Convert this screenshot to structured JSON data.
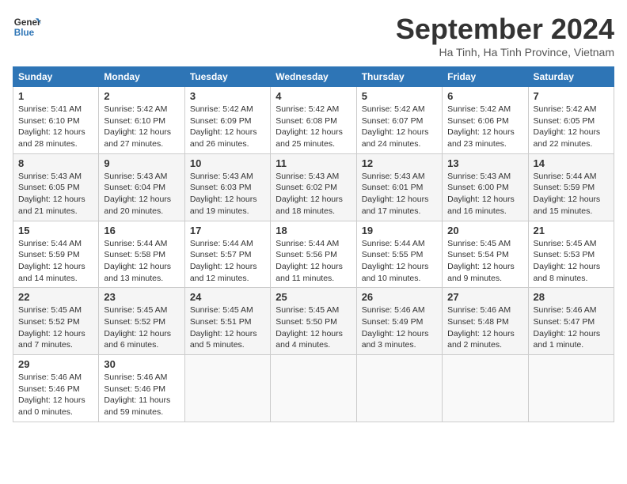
{
  "header": {
    "logo_line1": "General",
    "logo_line2": "Blue",
    "month_title": "September 2024",
    "location": "Ha Tinh, Ha Tinh Province, Vietnam"
  },
  "days_of_week": [
    "Sunday",
    "Monday",
    "Tuesday",
    "Wednesday",
    "Thursday",
    "Friday",
    "Saturday"
  ],
  "weeks": [
    [
      {
        "day": "1",
        "lines": [
          "Sunrise: 5:41 AM",
          "Sunset: 6:10 PM",
          "Daylight: 12 hours",
          "and 28 minutes."
        ]
      },
      {
        "day": "2",
        "lines": [
          "Sunrise: 5:42 AM",
          "Sunset: 6:10 PM",
          "Daylight: 12 hours",
          "and 27 minutes."
        ]
      },
      {
        "day": "3",
        "lines": [
          "Sunrise: 5:42 AM",
          "Sunset: 6:09 PM",
          "Daylight: 12 hours",
          "and 26 minutes."
        ]
      },
      {
        "day": "4",
        "lines": [
          "Sunrise: 5:42 AM",
          "Sunset: 6:08 PM",
          "Daylight: 12 hours",
          "and 25 minutes."
        ]
      },
      {
        "day": "5",
        "lines": [
          "Sunrise: 5:42 AM",
          "Sunset: 6:07 PM",
          "Daylight: 12 hours",
          "and 24 minutes."
        ]
      },
      {
        "day": "6",
        "lines": [
          "Sunrise: 5:42 AM",
          "Sunset: 6:06 PM",
          "Daylight: 12 hours",
          "and 23 minutes."
        ]
      },
      {
        "day": "7",
        "lines": [
          "Sunrise: 5:42 AM",
          "Sunset: 6:05 PM",
          "Daylight: 12 hours",
          "and 22 minutes."
        ]
      }
    ],
    [
      {
        "day": "8",
        "lines": [
          "Sunrise: 5:43 AM",
          "Sunset: 6:05 PM",
          "Daylight: 12 hours",
          "and 21 minutes."
        ]
      },
      {
        "day": "9",
        "lines": [
          "Sunrise: 5:43 AM",
          "Sunset: 6:04 PM",
          "Daylight: 12 hours",
          "and 20 minutes."
        ]
      },
      {
        "day": "10",
        "lines": [
          "Sunrise: 5:43 AM",
          "Sunset: 6:03 PM",
          "Daylight: 12 hours",
          "and 19 minutes."
        ]
      },
      {
        "day": "11",
        "lines": [
          "Sunrise: 5:43 AM",
          "Sunset: 6:02 PM",
          "Daylight: 12 hours",
          "and 18 minutes."
        ]
      },
      {
        "day": "12",
        "lines": [
          "Sunrise: 5:43 AM",
          "Sunset: 6:01 PM",
          "Daylight: 12 hours",
          "and 17 minutes."
        ]
      },
      {
        "day": "13",
        "lines": [
          "Sunrise: 5:43 AM",
          "Sunset: 6:00 PM",
          "Daylight: 12 hours",
          "and 16 minutes."
        ]
      },
      {
        "day": "14",
        "lines": [
          "Sunrise: 5:44 AM",
          "Sunset: 5:59 PM",
          "Daylight: 12 hours",
          "and 15 minutes."
        ]
      }
    ],
    [
      {
        "day": "15",
        "lines": [
          "Sunrise: 5:44 AM",
          "Sunset: 5:59 PM",
          "Daylight: 12 hours",
          "and 14 minutes."
        ]
      },
      {
        "day": "16",
        "lines": [
          "Sunrise: 5:44 AM",
          "Sunset: 5:58 PM",
          "Daylight: 12 hours",
          "and 13 minutes."
        ]
      },
      {
        "day": "17",
        "lines": [
          "Sunrise: 5:44 AM",
          "Sunset: 5:57 PM",
          "Daylight: 12 hours",
          "and 12 minutes."
        ]
      },
      {
        "day": "18",
        "lines": [
          "Sunrise: 5:44 AM",
          "Sunset: 5:56 PM",
          "Daylight: 12 hours",
          "and 11 minutes."
        ]
      },
      {
        "day": "19",
        "lines": [
          "Sunrise: 5:44 AM",
          "Sunset: 5:55 PM",
          "Daylight: 12 hours",
          "and 10 minutes."
        ]
      },
      {
        "day": "20",
        "lines": [
          "Sunrise: 5:45 AM",
          "Sunset: 5:54 PM",
          "Daylight: 12 hours",
          "and 9 minutes."
        ]
      },
      {
        "day": "21",
        "lines": [
          "Sunrise: 5:45 AM",
          "Sunset: 5:53 PM",
          "Daylight: 12 hours",
          "and 8 minutes."
        ]
      }
    ],
    [
      {
        "day": "22",
        "lines": [
          "Sunrise: 5:45 AM",
          "Sunset: 5:52 PM",
          "Daylight: 12 hours",
          "and 7 minutes."
        ]
      },
      {
        "day": "23",
        "lines": [
          "Sunrise: 5:45 AM",
          "Sunset: 5:52 PM",
          "Daylight: 12 hours",
          "and 6 minutes."
        ]
      },
      {
        "day": "24",
        "lines": [
          "Sunrise: 5:45 AM",
          "Sunset: 5:51 PM",
          "Daylight: 12 hours",
          "and 5 minutes."
        ]
      },
      {
        "day": "25",
        "lines": [
          "Sunrise: 5:45 AM",
          "Sunset: 5:50 PM",
          "Daylight: 12 hours",
          "and 4 minutes."
        ]
      },
      {
        "day": "26",
        "lines": [
          "Sunrise: 5:46 AM",
          "Sunset: 5:49 PM",
          "Daylight: 12 hours",
          "and 3 minutes."
        ]
      },
      {
        "day": "27",
        "lines": [
          "Sunrise: 5:46 AM",
          "Sunset: 5:48 PM",
          "Daylight: 12 hours",
          "and 2 minutes."
        ]
      },
      {
        "day": "28",
        "lines": [
          "Sunrise: 5:46 AM",
          "Sunset: 5:47 PM",
          "Daylight: 12 hours",
          "and 1 minute."
        ]
      }
    ],
    [
      {
        "day": "29",
        "lines": [
          "Sunrise: 5:46 AM",
          "Sunset: 5:46 PM",
          "Daylight: 12 hours",
          "and 0 minutes."
        ]
      },
      {
        "day": "30",
        "lines": [
          "Sunrise: 5:46 AM",
          "Sunset: 5:46 PM",
          "Daylight: 11 hours",
          "and 59 minutes."
        ]
      },
      {
        "day": "",
        "lines": []
      },
      {
        "day": "",
        "lines": []
      },
      {
        "day": "",
        "lines": []
      },
      {
        "day": "",
        "lines": []
      },
      {
        "day": "",
        "lines": []
      }
    ]
  ]
}
